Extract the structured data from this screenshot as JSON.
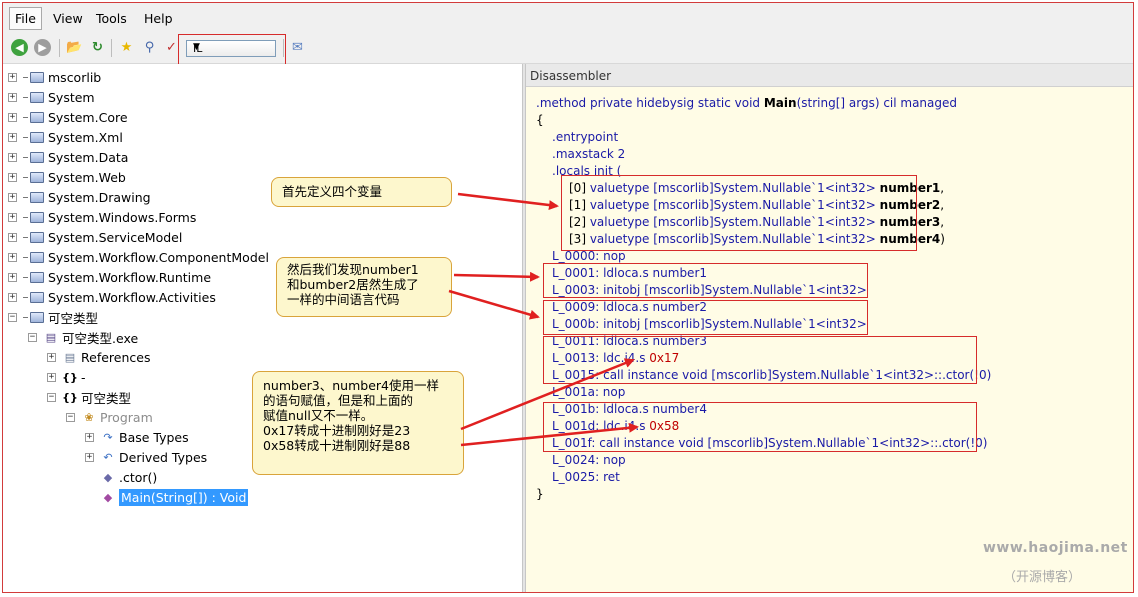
{
  "menu": {
    "file": "File",
    "view": "View",
    "tools": "Tools",
    "help": "Help"
  },
  "toolbar": {
    "language_value": "IL"
  },
  "tree": {
    "assemblies": [
      "mscorlib",
      "System",
      "System.Core",
      "System.Xml",
      "System.Data",
      "System.Web",
      "System.Drawing",
      "System.Windows.Forms",
      "System.ServiceModel",
      "System.Workflow.ComponentModel",
      "System.Workflow.Runtime",
      "System.Workflow.Activities"
    ],
    "target_assembly": "可空类型",
    "module": "可空类型.exe",
    "references": "References",
    "ns_empty": "-",
    "ns_main": "可空类型",
    "class_name": "Program",
    "base_types": "Base Types",
    "derived_types": "Derived Types",
    "ctor": ".ctor()",
    "main_method": "Main(String[]) : Void"
  },
  "panel": {
    "header": "Disassembler"
  },
  "code": {
    "sig_method": ".method private hidebysig static void ",
    "sig_name": "Main",
    "sig_params": "(string[] args) ",
    "sig_tail": "cil managed",
    "brace_open": "{",
    "entrypoint": ".entrypoint",
    "maxstack": ".maxstack 2",
    "locals": ".locals init (",
    "loc0": {
      "prefix": "[0] ",
      "kw": "valuetype ",
      "type": "[mscorlib]System.Nullable`1<int32> ",
      "name": "number1",
      "tail": ","
    },
    "loc1": {
      "prefix": "[1] ",
      "kw": "valuetype ",
      "type": "[mscorlib]System.Nullable`1<int32> ",
      "name": "number2",
      "tail": ","
    },
    "loc2": {
      "prefix": "[2] ",
      "kw": "valuetype ",
      "type": "[mscorlib]System.Nullable`1<int32> ",
      "name": "number3",
      "tail": ","
    },
    "loc3": {
      "prefix": "[3] ",
      "kw": "valuetype ",
      "type": "[mscorlib]System.Nullable`1<int32> ",
      "name": "number4",
      "tail": ")"
    },
    "l0000": "L_0000: nop",
    "l0001": "L_0001: ldloca.s number1",
    "l0003": {
      "label": "L_0003: ",
      "op": "initobj ",
      "type": "[mscorlib]System.Nullable`1<int32>"
    },
    "l0009": "L_0009: ldloca.s number2",
    "l000b": {
      "label": "L_000b: ",
      "op": "initobj ",
      "type": "[mscorlib]System.Nullable`1<int32>"
    },
    "l0011": "L_0011: ldloca.s number3",
    "l0013": {
      "text": "L_0013: ldc.i4.s ",
      "val": "0x17"
    },
    "l0015": {
      "label": "L_0015: ",
      "op": "call instance void ",
      "type": "[mscorlib]System.Nullable`1<int32>::.ctor(!0)"
    },
    "l001a": "L_001a: nop",
    "l001b": "L_001b: ldloca.s number4",
    "l001d": {
      "text": "L_001d: ldc.i4.s ",
      "val": "0x58"
    },
    "l001f": {
      "label": "L_001f: ",
      "op": "call instance void ",
      "type": "[mscorlib]System.Nullable`1<int32>::.ctor(!0)"
    },
    "l0024": "L_0024: nop",
    "l0025": "L_0025: ret",
    "brace_close": "}"
  },
  "annotations": {
    "a1": "首先定义四个变量",
    "a2": [
      "然后我们发现number1",
      "和bumber2居然生成了",
      "一样的中间语言代码"
    ],
    "a3": [
      "number3、number4使用一样",
      "的语句赋值，但是和上面的",
      "赋值null又不一样。",
      "0x17转成十进制刚好是23",
      "0x58转成十进制刚好是88"
    ]
  },
  "watermark": {
    "url": "www.haojima.net",
    "name": "（开源博客）"
  },
  "colors": {
    "annotation_border": "#d62b2b",
    "keyword": "#1a1aa6",
    "panel_bg": "#fffce6",
    "callout_bg": "#fdf7cd"
  }
}
